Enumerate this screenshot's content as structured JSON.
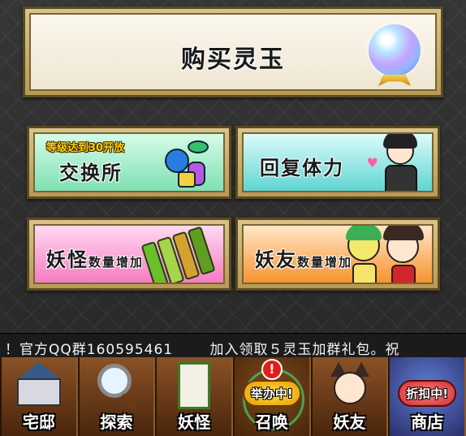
{
  "buy_button": {
    "label": "购买灵玉"
  },
  "menu": {
    "exchange": {
      "sub": "等级达到30开放",
      "label": "交换所"
    },
    "recover": {
      "label": "回复体力"
    },
    "yokai_increase": {
      "main": "妖怪",
      "suffix": "数量增加"
    },
    "friend_increase": {
      "main": "妖友",
      "suffix": "数量增加"
    }
  },
  "ticker": {
    "msg1": "！官方QQ群160595461",
    "msg2": "加入领取５灵玉加群礼包。祝"
  },
  "tabs": [
    {
      "id": "home",
      "label": "宅邸"
    },
    {
      "id": "explore",
      "label": "探索"
    },
    {
      "id": "yokai",
      "label": "妖怪"
    },
    {
      "id": "summon",
      "label": "召唤",
      "badge": "举办中!",
      "alert": "!"
    },
    {
      "id": "friend",
      "label": "妖友"
    },
    {
      "id": "shop",
      "label": "商店",
      "badge": "折扣中!"
    }
  ]
}
